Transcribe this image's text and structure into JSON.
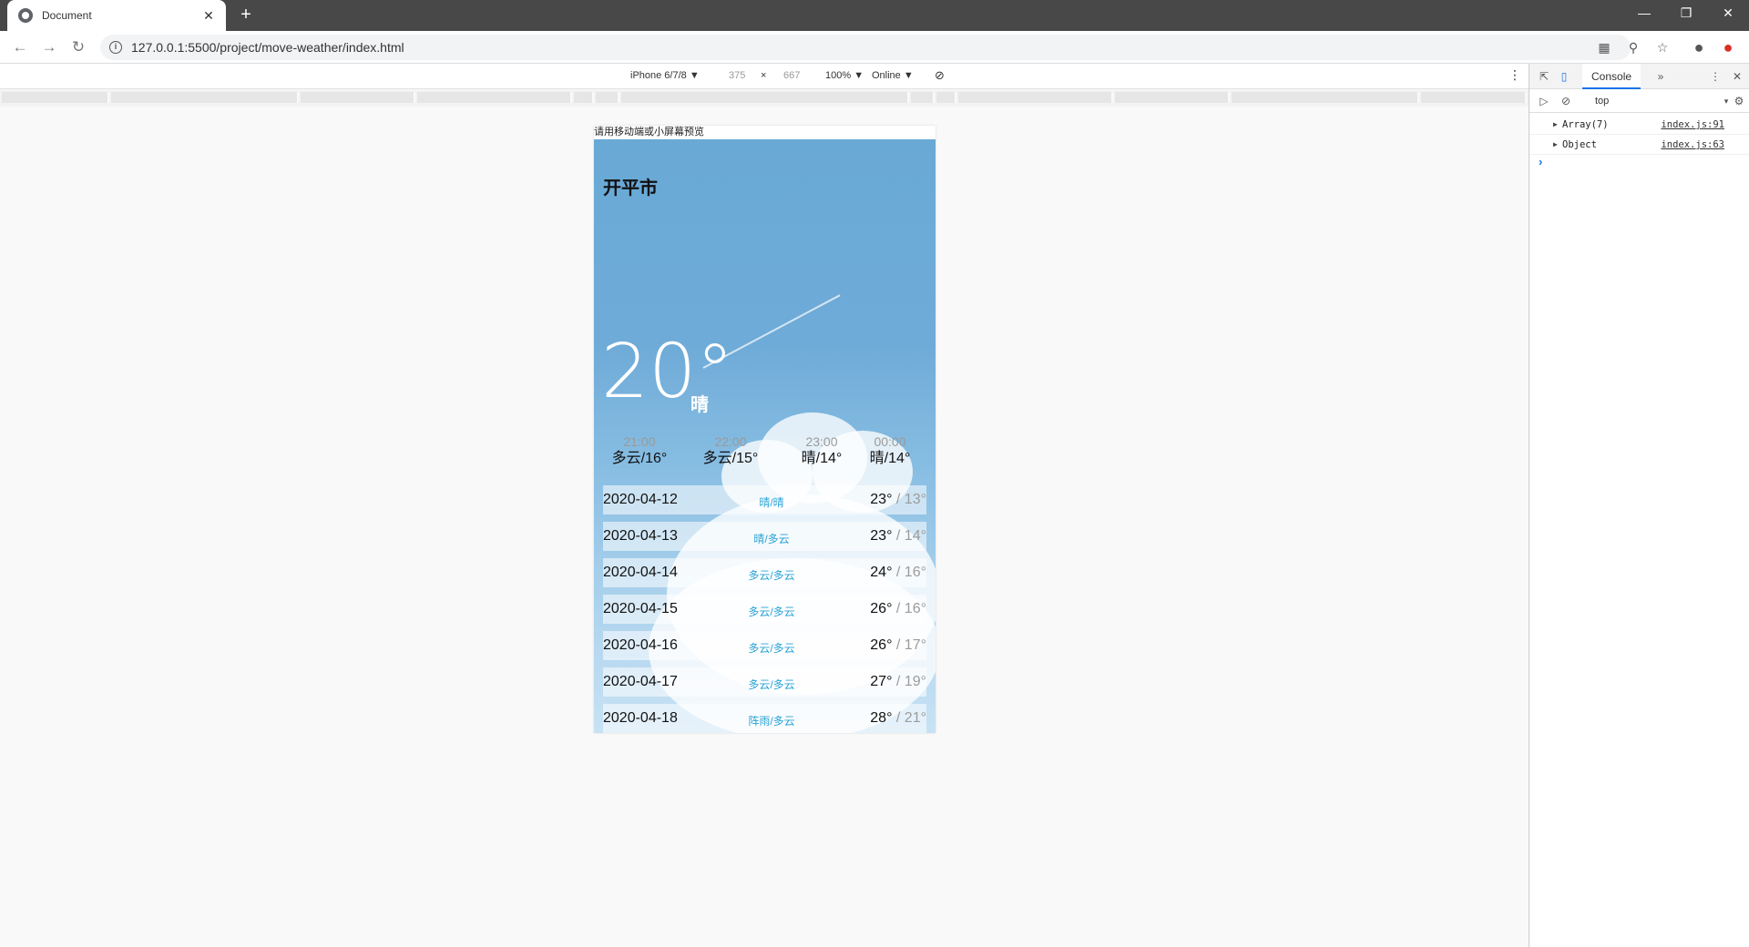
{
  "browser": {
    "tab_title": "Document",
    "tab_close": "✕",
    "new_tab": "+",
    "url": "127.0.0.1:5500/project/move-weather/index.html",
    "info": "i"
  },
  "device_toolbar": {
    "device": "iPhone 6/7/8 ▼",
    "width": "375",
    "times": "×",
    "height": "667",
    "zoom": "100% ▼",
    "network": "Online ▼"
  },
  "phone": {
    "notice": "请用移动端或小屏幕预览",
    "city": "开平市",
    "temperature": "20°",
    "condition": "晴",
    "hourly": [
      {
        "time": "21:00",
        "value": "多云/16°"
      },
      {
        "time": "22:00",
        "value": "多云/15°"
      },
      {
        "time": "23:00",
        "value": "晴/14°"
      },
      {
        "time": "00:00",
        "value": "晴/14°"
      }
    ],
    "daily": [
      {
        "date": "2020-04-12",
        "cond": "晴/晴",
        "hi": "23°",
        "lo": " / 13°"
      },
      {
        "date": "2020-04-13",
        "cond": "晴/多云",
        "hi": "23°",
        "lo": " / 14°"
      },
      {
        "date": "2020-04-14",
        "cond": "多云/多云",
        "hi": "24°",
        "lo": " / 16°"
      },
      {
        "date": "2020-04-15",
        "cond": "多云/多云",
        "hi": "26°",
        "lo": " / 16°"
      },
      {
        "date": "2020-04-16",
        "cond": "多云/多云",
        "hi": "26°",
        "lo": " / 17°"
      },
      {
        "date": "2020-04-17",
        "cond": "多云/多云",
        "hi": "27°",
        "lo": " / 19°"
      },
      {
        "date": "2020-04-18",
        "cond": "阵雨/多云",
        "hi": "28°",
        "lo": " / 21°"
      }
    ]
  },
  "devtools": {
    "tab": "Console",
    "context": "top",
    "logs": [
      {
        "msg": "Array(7)",
        "src": "index.js:91"
      },
      {
        "msg": "Object",
        "src": "index.js:63"
      }
    ],
    "prompt": "›"
  }
}
